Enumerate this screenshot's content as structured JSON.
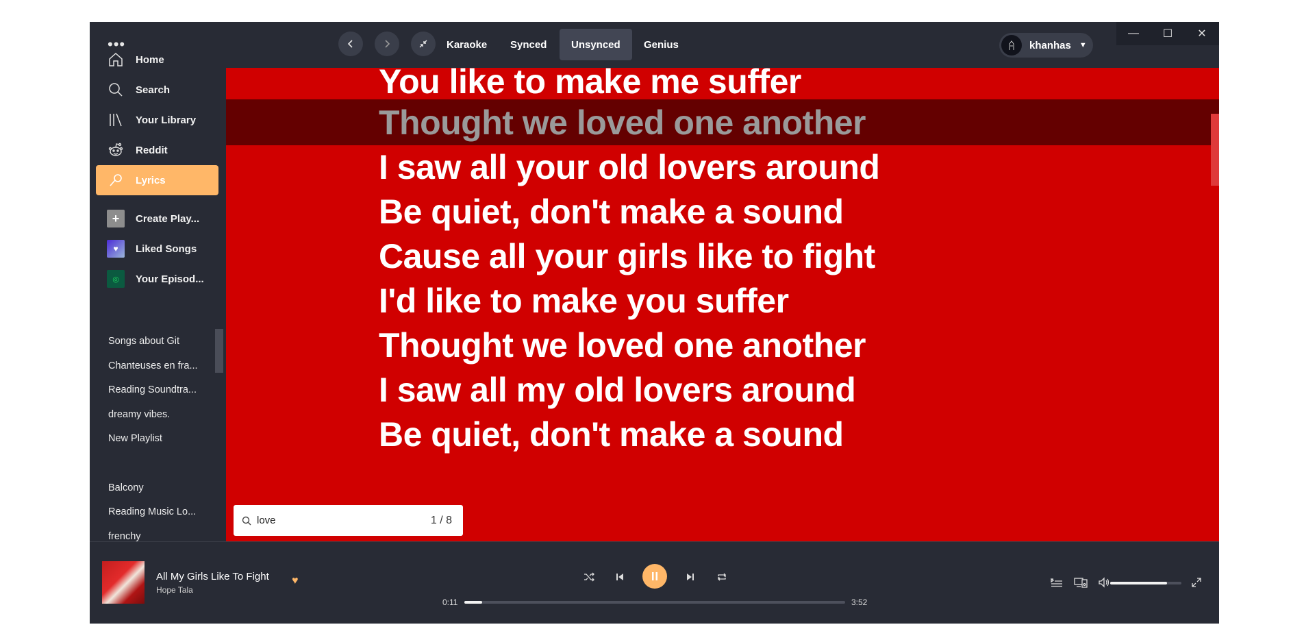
{
  "sidebar": {
    "menu_dots": "•••",
    "nav": [
      {
        "label": "Home",
        "icon": "home-icon"
      },
      {
        "label": "Search",
        "icon": "search-icon"
      },
      {
        "label": "Your Library",
        "icon": "library-icon"
      },
      {
        "label": "Reddit",
        "icon": "reddit-icon"
      },
      {
        "label": "Lyrics",
        "icon": "microphone-icon",
        "active": true
      }
    ],
    "shortcuts": [
      {
        "label": "Create Play...",
        "icon": "plus-icon"
      },
      {
        "label": "Liked Songs",
        "icon": "heart-icon"
      },
      {
        "label": "Your Episod...",
        "icon": "podcast-icon"
      }
    ],
    "playlists": [
      "Songs about Git",
      "Chanteuses en fra...",
      "Reading Soundtra...",
      "dreamy vibes.",
      "New Playlist",
      "Balcony",
      "Reading Music Lo...",
      "frenchy"
    ]
  },
  "topbar": {
    "tabs": [
      "Karaoke",
      "Synced",
      "Unsynced",
      "Genius"
    ],
    "active_tab": "Unsynced",
    "username": "khanhas",
    "window_controls": [
      "minimize",
      "maximize",
      "close"
    ]
  },
  "lyrics": {
    "lines": [
      "You like to make me suffer",
      "Thought we loved one another",
      "I saw all your old lovers around",
      "Be quiet, don't make a sound",
      "Cause all your girls like to fight",
      "I'd like to make you suffer",
      "Thought we loved one another",
      "I saw all my old lovers around",
      "Be quiet, don't make a sound"
    ],
    "highlighted_index": 1,
    "background_color": "#d00000",
    "highlight_color": "#640000"
  },
  "find": {
    "query": "love",
    "count": "1 / 8"
  },
  "player": {
    "title": "All My Girls Like To Fight",
    "artist": "Hope Tala",
    "liked": true,
    "time_current": "0:11",
    "time_total": "3:52",
    "progress_fraction": 0.047,
    "volume_fraction": 0.8,
    "accent_color": "#ffb768"
  }
}
